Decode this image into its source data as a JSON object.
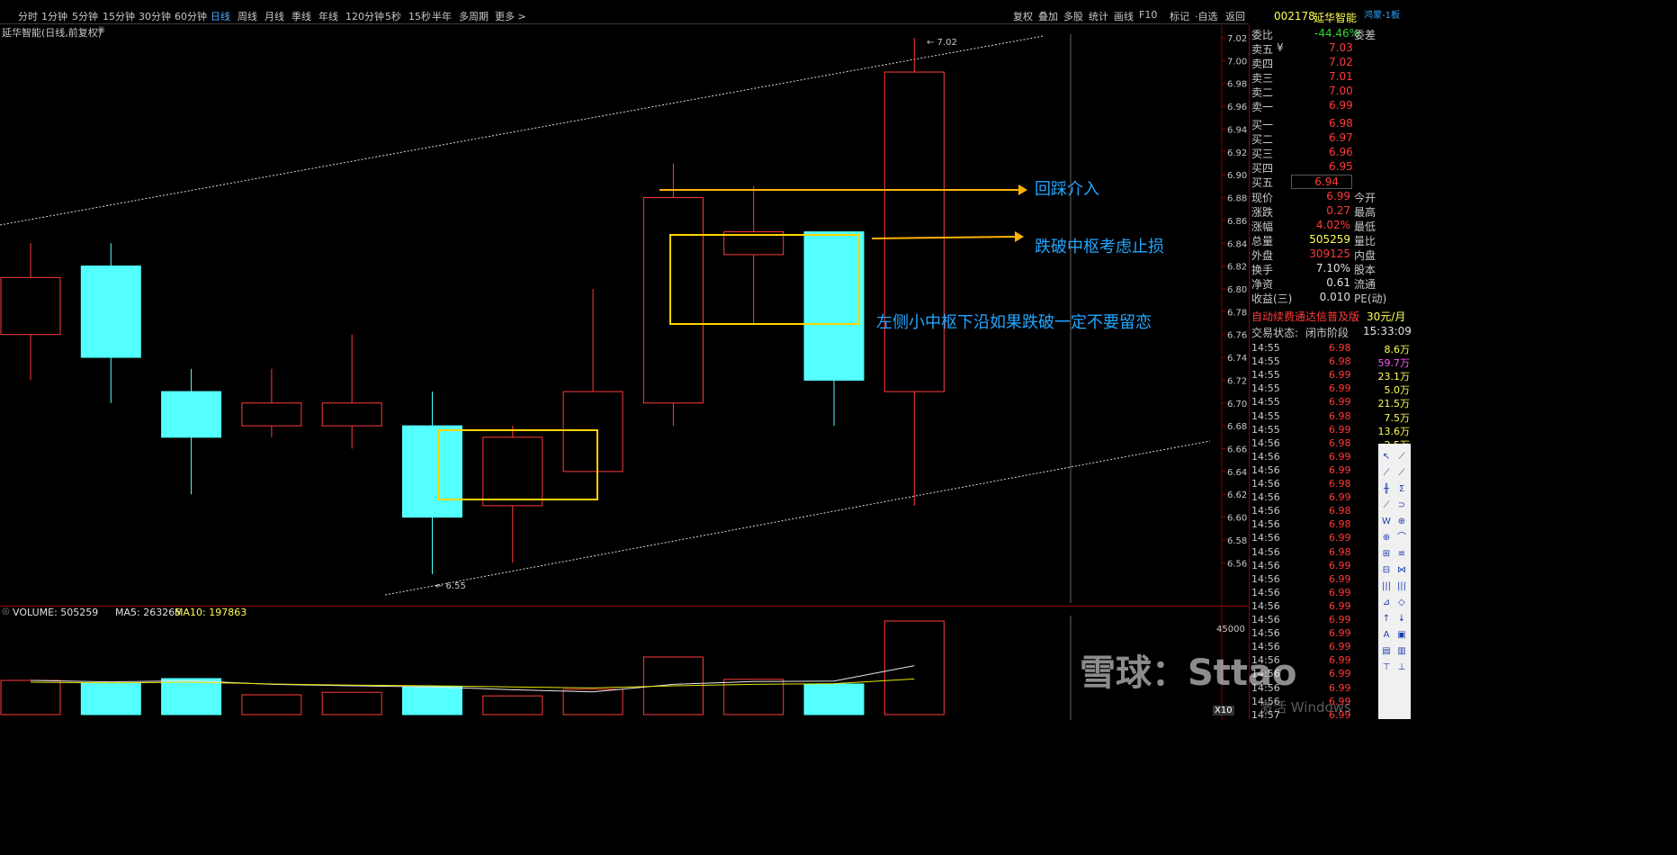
{
  "toolbar": {
    "periods": [
      "分时",
      "1分钟",
      "5分钟",
      "15分钟",
      "30分钟",
      "60分钟",
      "日线",
      "周线",
      "月线",
      "季线",
      "年线",
      "120分钟",
      "5秒",
      "15秒",
      "半年",
      "多周期",
      "更多 >"
    ],
    "active_period": "日线",
    "right_tools": [
      "复权",
      "叠加",
      "多股",
      "统计",
      "画线",
      "F10",
      "标记",
      "·自选",
      "返回"
    ]
  },
  "stock": {
    "code": "002178",
    "name": "延华智能",
    "tag": "鸿蒙-1板",
    "chart_title": "延华智能(日线,前复权)"
  },
  "orderbook": {
    "weibi_label": "委比",
    "weibi_value": "-44.46%",
    "weicha_label": "委差",
    "asks": [
      {
        "label": "卖五",
        "sym": "¥",
        "price": "7.03"
      },
      {
        "label": "卖四",
        "sym": "",
        "price": "7.02"
      },
      {
        "label": "卖三",
        "sym": "",
        "price": "7.01"
      },
      {
        "label": "卖二",
        "sym": "",
        "price": "7.00"
      },
      {
        "label": "卖一",
        "sym": "",
        "price": "6.99"
      }
    ],
    "bids": [
      {
        "label": "买一",
        "price": "6.98"
      },
      {
        "label": "买二",
        "price": "6.97"
      },
      {
        "label": "买三",
        "price": "6.96"
      },
      {
        "label": "买四",
        "price": "6.95"
      },
      {
        "label": "买五",
        "price": "6.94"
      }
    ],
    "stats": [
      {
        "l1": "现价",
        "v": "6.99",
        "l2": "今开",
        "color": "#ff3b3b"
      },
      {
        "l1": "涨跌",
        "v": "0.27",
        "l2": "最高",
        "color": "#ff3b3b"
      },
      {
        "l1": "涨幅",
        "v": "4.02%",
        "l2": "最低",
        "color": "#ff3b3b"
      },
      {
        "l1": "总量",
        "v": "505259",
        "l2": "量比",
        "color": "#ffff54"
      },
      {
        "l1": "外盘",
        "v": "309125",
        "l2": "内盘",
        "color": "#ff3b3b"
      },
      {
        "l1": "换手",
        "v": "7.10%",
        "l2": "股本",
        "color": "#e0e0e0"
      },
      {
        "l1": "净资",
        "v": "0.61",
        "l2": "流通",
        "color": "#e0e0e0"
      },
      {
        "l1": "收益(三)",
        "v": "0.010",
        "l2": "PE(动)",
        "color": "#e0e0e0"
      }
    ],
    "promo": "自动续费通达信普及版",
    "promo_price": "30元/月",
    "trade_status_label": "交易状态:",
    "trade_status": "闭市阶段",
    "trade_time": "15:33:09"
  },
  "ticks": [
    {
      "t": "14:55",
      "p": "6.98",
      "v": "8.6万",
      "vc": "#ffff54"
    },
    {
      "t": "14:55",
      "p": "6.98",
      "v": "59.7万",
      "vc": "#ff54ff"
    },
    {
      "t": "14:55",
      "p": "6.99",
      "v": "23.1万",
      "vc": "#ffff54"
    },
    {
      "t": "14:55",
      "p": "6.99",
      "v": "5.0万",
      "vc": "#ffff54"
    },
    {
      "t": "14:55",
      "p": "6.99",
      "v": "21.5万",
      "vc": "#ffff54"
    },
    {
      "t": "14:55",
      "p": "6.98",
      "v": "7.5万",
      "vc": "#ffff54"
    },
    {
      "t": "14:55",
      "p": "6.99",
      "v": "13.6万",
      "vc": "#ffff54"
    },
    {
      "t": "14:56",
      "p": "6.98",
      "v": "2.5万",
      "vc": "#ffff54"
    },
    {
      "t": "14:56",
      "p": "6.99",
      "v": "",
      "vc": "#ffff54"
    },
    {
      "t": "14:56",
      "p": "6.99",
      "v": "",
      "vc": "#ffff54"
    },
    {
      "t": "14:56",
      "p": "6.98",
      "v": "",
      "vc": "#ffff54"
    },
    {
      "t": "14:56",
      "p": "6.99",
      "v": "",
      "vc": "#ffff54"
    },
    {
      "t": "14:56",
      "p": "6.98",
      "v": "",
      "vc": "#ffff54"
    },
    {
      "t": "14:56",
      "p": "6.98",
      "v": "",
      "vc": "#ffff54"
    },
    {
      "t": "14:56",
      "p": "6.99",
      "v": "",
      "vc": "#ffff54"
    },
    {
      "t": "14:56",
      "p": "6.98",
      "v": "",
      "vc": "#ffff54"
    },
    {
      "t": "14:56",
      "p": "6.99",
      "v": "",
      "vc": "#ffff54"
    },
    {
      "t": "14:56",
      "p": "6.99",
      "v": "",
      "vc": "#ffff54"
    },
    {
      "t": "14:56",
      "p": "6.99",
      "v": "",
      "vc": "#ffff54"
    },
    {
      "t": "14:56",
      "p": "6.99",
      "v": "",
      "vc": "#ffff54"
    },
    {
      "t": "14:56",
      "p": "6.99",
      "v": "",
      "vc": "#ffff54"
    },
    {
      "t": "14:56",
      "p": "6.99",
      "v": "",
      "vc": "#ffff54"
    },
    {
      "t": "14:56",
      "p": "6.99",
      "v": "",
      "vc": "#ffff54"
    },
    {
      "t": "14:56",
      "p": "6.99",
      "v": "",
      "vc": "#ffff54"
    },
    {
      "t": "14:56",
      "p": "6.99",
      "v": "",
      "vc": "#ffff54"
    },
    {
      "t": "14:56",
      "p": "6.99",
      "v": "",
      "vc": "#ffff54"
    },
    {
      "t": "14:56",
      "p": "6.99",
      "v": "",
      "vc": "#ffff54"
    },
    {
      "t": "14:57",
      "p": "6.99",
      "v": "",
      "vc": "#ffff54"
    }
  ],
  "annotations": {
    "a1": "回踩介入",
    "a2": "跌破中枢考虑止损",
    "a3": "左侧小中枢下沿如果跌破一定不要留恋",
    "high_label": "7.02",
    "low_label": "6.55"
  },
  "volume": {
    "label": "VOLUME: 505259",
    "ma5": "MA5: 263265",
    "ma10": "MA10: 197863",
    "y_ticks": [
      "45000"
    ],
    "x10": "X10"
  },
  "watermark": "雪球：Sttao",
  "windows_mark": "激活 Windows",
  "chart_data": {
    "type": "candlestick",
    "ylim": [
      6.55,
      7.02
    ],
    "y_ticks": [
      7.02,
      7.0,
      6.98,
      6.96,
      6.94,
      6.92,
      6.9,
      6.88,
      6.86,
      6.84,
      6.82,
      6.8,
      6.78,
      6.76,
      6.74,
      6.72,
      6.7,
      6.68,
      6.66,
      6.64,
      6.62,
      6.6,
      6.58,
      6.56
    ],
    "candles": [
      {
        "o": 6.76,
        "c": 6.81,
        "h": 6.84,
        "l": 6.72,
        "up": true
      },
      {
        "o": 6.82,
        "c": 6.74,
        "h": 6.84,
        "l": 6.7,
        "up": false
      },
      {
        "o": 6.71,
        "c": 6.67,
        "h": 6.73,
        "l": 6.62,
        "up": false
      },
      {
        "o": 6.68,
        "c": 6.7,
        "h": 6.73,
        "l": 6.67,
        "up": true
      },
      {
        "o": 6.68,
        "c": 6.7,
        "h": 6.76,
        "l": 6.66,
        "up": true
      },
      {
        "o": 6.68,
        "c": 6.6,
        "h": 6.71,
        "l": 6.55,
        "up": false
      },
      {
        "o": 6.61,
        "c": 6.67,
        "h": 6.68,
        "l": 6.56,
        "up": true
      },
      {
        "o": 6.64,
        "c": 6.71,
        "h": 6.8,
        "l": 6.64,
        "up": true
      },
      {
        "o": 6.7,
        "c": 6.88,
        "h": 6.91,
        "l": 6.68,
        "up": true
      },
      {
        "o": 6.83,
        "c": 6.85,
        "h": 6.89,
        "l": 6.77,
        "up": true
      },
      {
        "o": 6.85,
        "c": 6.72,
        "h": 6.85,
        "l": 6.68,
        "up": false
      },
      {
        "o": 6.71,
        "c": 6.99,
        "h": 7.02,
        "l": 6.61,
        "up": true
      }
    ],
    "volumes": [
      95000,
      88000,
      100000,
      55000,
      62000,
      78000,
      52000,
      70000,
      160000,
      98000,
      85000,
      260000
    ],
    "vol_ylim": [
      0,
      260000
    ]
  }
}
